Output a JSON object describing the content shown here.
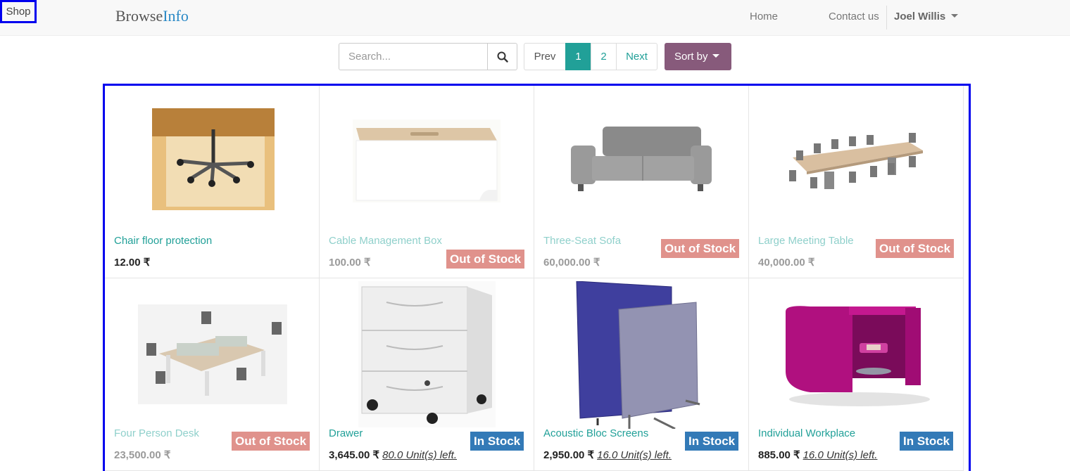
{
  "nav": {
    "brand_part1": "Browse",
    "brand_part2": "Info",
    "home": "Home",
    "shop": "Shop",
    "contact": "Contact us",
    "user": "Joel Willis"
  },
  "toolbar": {
    "search_placeholder": "Search...",
    "prev": "Prev",
    "page1": "1",
    "page2": "2",
    "next": "Next",
    "sort": "Sort by"
  },
  "products": [
    {
      "name": "Chair floor protection",
      "price": "12.00 ₹",
      "badge": "",
      "units": ""
    },
    {
      "name": "Cable Management Box",
      "price": "100.00 ₹",
      "badge": "Out of Stock",
      "units": ""
    },
    {
      "name": "Three-Seat Sofa",
      "price": "60,000.00 ₹",
      "badge": "Out of Stock",
      "units": ""
    },
    {
      "name": "Large Meeting Table",
      "price": "40,000.00 ₹",
      "badge": "Out of Stock",
      "units": ""
    },
    {
      "name": "Four Person Desk",
      "price": "23,500.00 ₹",
      "badge": "Out of Stock",
      "units": ""
    },
    {
      "name": "Drawer",
      "price": "3,645.00 ₹",
      "badge": "In Stock",
      "units": "80.0 Unit(s) left."
    },
    {
      "name": "Acoustic Bloc Screens",
      "price": "2,950.00 ₹",
      "badge": "In Stock",
      "units": "16.0 Unit(s) left."
    },
    {
      "name": "Individual Workplace",
      "price": "885.00 ₹",
      "badge": "In Stock",
      "units": "16.0 Unit(s) left."
    }
  ],
  "colors": {
    "accent": "#21a098",
    "sort_button": "#875a7b",
    "out_of_stock": "#e0928c",
    "in_stock": "#337ab7",
    "highlight_border": "#0000ee"
  }
}
